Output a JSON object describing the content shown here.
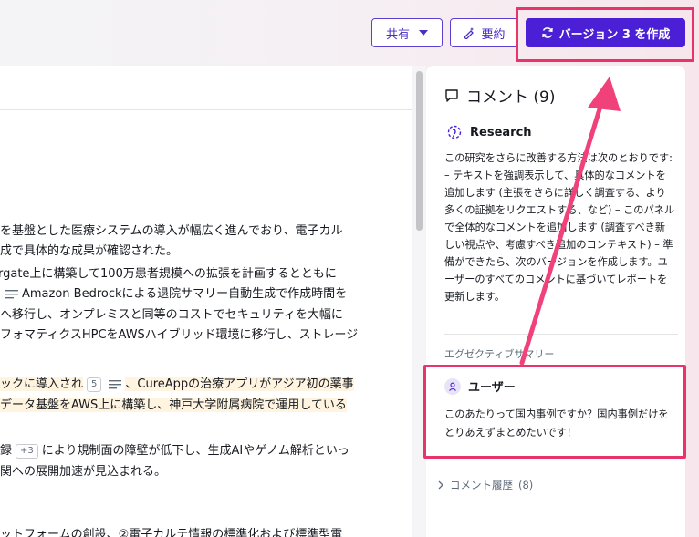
{
  "toolbar": {
    "share_label": "共有",
    "summary_label": "要約",
    "create_version_label": "バージョン 3 を作成"
  },
  "document": {
    "lines": [
      "を基盤とした医療システムの導入が幅広く進んでおり、電子カル",
      "成で具体的な成果が確認された。",
      "rgate上に構築して100万患者規模への拡張を計画するとともに",
      "Amazon Bedrockによる退院サマリー自動生成で作成時間を",
      "へ移行し、オンプレミスと同等のコストでセキュリティを大幅に",
      "フォマティクスHPCをAWSハイブリッド環境に移行し、ストレージ",
      "ックに導入され",
      "、CureAppの治療アプリがアジア初の薬事",
      "データ基盤をAWS上に構築し、神戸大学附属病院で運用している",
      "録",
      "により規制面の障壁が低下し、生成AIやゲノム解析といっ",
      "関への展開加速が見込まれる。",
      "ットフォームの創設、②電子カルテ情報の標準化および標準型電"
    ],
    "badges": {
      "b5": "5",
      "b3": "+3"
    }
  },
  "comments": {
    "title": "コメント (9)",
    "research": {
      "author": "Research",
      "body": "この研究をさらに改善する方法は次のとおりです: – テキストを強調表示して、具体的なコメントを追加します (主張をさらに詳しく調査する、より多くの証拠をリクエストする、など) – このパネルで全体的なコメントを追加します (調査すべき新しい視点や、考慮すべき追加のコンテキスト) – 準備ができたら、次のバージョンを作成します。ユーザーのすべてのコメントに基づいてレポートを更新します。"
    },
    "section_label": "エグゼクティブサマリー",
    "user": {
      "author": "ユーザー",
      "body": "このあたりって国内事例ですか？国内事例だけをとりあえずまとめたいです！"
    },
    "history_label": "コメント履歴",
    "history_count": "(8)"
  },
  "colors": {
    "accent": "#4a1fd6",
    "highlight_annotation": "#e8336b",
    "text_highlight": "#fff4e0"
  }
}
